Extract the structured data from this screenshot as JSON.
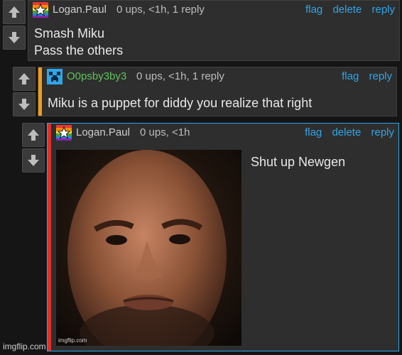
{
  "comments": [
    {
      "username": "Logan.Paul",
      "meta": "0 ups, <1h, 1 reply",
      "actions": [
        "flag",
        "delete",
        "reply"
      ],
      "body_lines": [
        "Smash Miku",
        "Pass the others"
      ]
    },
    {
      "username": "O0psby3by3",
      "meta": "0 ups, <1h, 1 reply",
      "actions": [
        "flag",
        "reply"
      ],
      "body_lines": [
        "Miku is a puppet for diddy you realize that right"
      ]
    },
    {
      "username": "Logan.Paul",
      "meta": "0 ups, <1h",
      "actions": [
        "flag",
        "delete",
        "reply"
      ],
      "body_lines": [
        "Shut up Newgen"
      ],
      "image_watermark": "imgflip.com"
    }
  ],
  "site_watermark": "imgflip.com",
  "icons": [
    "upvote-icon",
    "downvote-icon",
    "rainbow-star-avatar-icon",
    "creeper-avatar-icon"
  ],
  "colors": {
    "link": "#2fa6e8",
    "username_green": "#5fc35a",
    "reply_bar_orange": "#f39a1a",
    "reply_bar_red": "#e0302a",
    "highlight_border": "#2fa6e8"
  }
}
